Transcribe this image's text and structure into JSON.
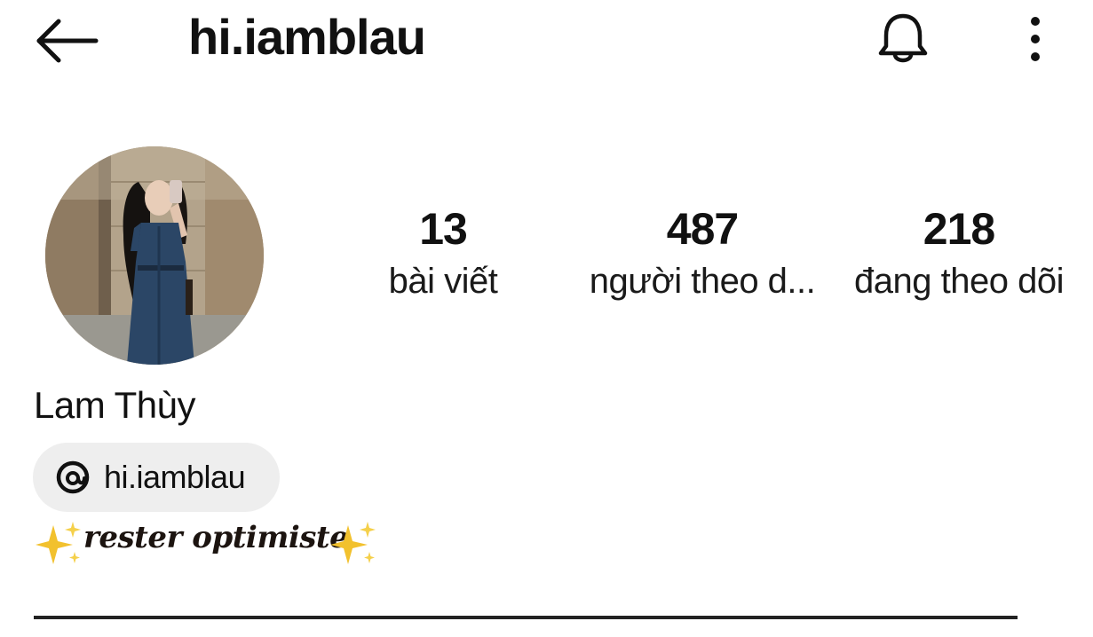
{
  "header": {
    "username": "hi.iamblau",
    "icons": [
      "back-arrow-icon",
      "bell-icon",
      "more-vertical-icon"
    ]
  },
  "profile": {
    "display_name": "Lam Thùy",
    "stats": {
      "posts": {
        "value": "13",
        "label": "bài viết"
      },
      "followers": {
        "value": "487",
        "label": "người theo d..."
      },
      "following": {
        "value": "218",
        "label": "đang theo dõi"
      }
    },
    "threads_link": {
      "label": "hi.iamblau",
      "icon": "threads-icon"
    },
    "bio": "rester optimiste",
    "bio_decorations": [
      "sparkles-icon",
      "sparkles-icon"
    ]
  },
  "colors": {
    "text": "#111111",
    "chip_background": "#eeeeee",
    "sparkle": "#f2c12e",
    "background": "#ffffff"
  }
}
